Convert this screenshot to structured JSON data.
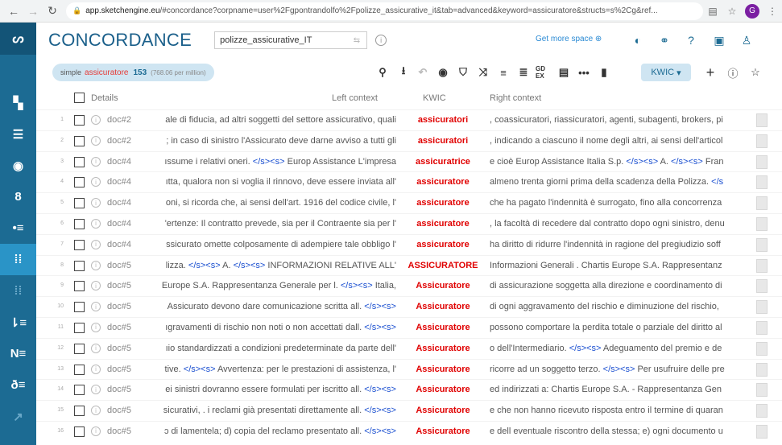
{
  "browser": {
    "url_host": "app.sketchengine.eu",
    "url_rest": "/#concordance?corpname=user%2Fgpontrandolfo%2Fpolizze_assicurative_it&tab=advanced&keyword=assicuratore&structs=s%2Cg&ref...",
    "profile_letter": "G"
  },
  "header": {
    "title": "CONCORDANCE",
    "corpus_name": "polizze_assicurative_IT",
    "get_more_space": "Get more space"
  },
  "query": {
    "type": "simple",
    "keyword": "assicuratore",
    "hits": "153",
    "per_million": "(768.06 per million)"
  },
  "toolbar": {
    "view_mode": "KWIC"
  },
  "columns": {
    "details": "Details",
    "left": "Left context",
    "kwic": "KWIC",
    "right": "Right context"
  },
  "rows": [
    {
      "n": "1",
      "doc": "doc#2",
      "left": "ale di fiducia, ad altri soggetti del settore assicurativo, quali",
      "kwic": "assicuratori",
      "right": ", coassicuratori, riassicuratori, agenti, subagenti, brokers, pi"
    },
    {
      "n": "2",
      "doc": "doc#2",
      "left": "; in caso di sinistro l'Assicurato deve darne avviso a tutti gli",
      "kwic": "assicuratori",
      "right": ", indicando a ciascuno il nome degli altri, ai sensi dell'articol"
    },
    {
      "n": "3",
      "doc": "doc#4",
      "left": "ıssume i relativi oneri. </s><s> Europ Assistance L'impresa",
      "kwic": "assicuratrice",
      "right": "e cioè Europ Assistance Italia S.p. </s><s> A. </s><s> Fran"
    },
    {
      "n": "4",
      "doc": "doc#4",
      "left": "ıtta, qualora non si voglia il rinnovo, deve essere inviata all'",
      "kwic": "assicuratore",
      "right": "almeno trenta giorni prima della scadenza della Polizza. </s"
    },
    {
      "n": "5",
      "doc": "doc#4",
      "left": "oni, si ricorda che, ai sensi dell'art. 1916 del codice civile, l'",
      "kwic": "assicuratore",
      "right": "che ha pagato l'indennità è surrogato, fino alla concorrenza"
    },
    {
      "n": "6",
      "doc": "doc#4",
      "left": "'ertenze: Il contratto prevede, sia per il Contraente sia per l'",
      "kwic": "assicuratore",
      "right": ", la facoltà di recedere dal contratto dopo ogni sinistro, denu"
    },
    {
      "n": "7",
      "doc": "doc#4",
      "left": "ssicurato omette colposamente di adempiere tale obbligo l'",
      "kwic": "assicuratore",
      "right": "ha diritto di ridurre l'indennità in ragione del pregiudizio soff"
    },
    {
      "n": "8",
      "doc": "doc#5",
      "left": "lizza. </s><s> A. </s><s> INFORMAZIONI RELATIVE ALL'",
      "kwic": "ASSICURATORE",
      "right": "Informazioni Generali . Chartis Europe S.A. Rappresentanz"
    },
    {
      "n": "9",
      "doc": "doc#5",
      "left": "Europe S.A. Rappresentanza Generale per l. </s><s> Italia,",
      "kwic": "Assicuratore",
      "right": "di assicurazione soggetta alla direzione e coordinamento di"
    },
    {
      "n": "10",
      "doc": "doc#5",
      "left": "Assicurato devono dare comunicazione scritta all. </s><s>",
      "kwic": "Assicuratore",
      "right": "di ogni aggravamento del rischio e diminuzione del rischio,"
    },
    {
      "n": "11",
      "doc": "doc#5",
      "left": "ıgravamenti di rischio non noti o non accettati dall. </s><s>",
      "kwic": "Assicuratore",
      "right": "possono comportare la perdita totale o parziale del diritto al"
    },
    {
      "n": "12",
      "doc": "doc#5",
      "left": "ıio standardizzati a condizioni predeterminate da parte dell'",
      "kwic": "Assicuratore",
      "right": "o dell'Intermediario. </s><s> Adeguamento del premio e de"
    },
    {
      "n": "13",
      "doc": "doc#5",
      "left": "tive. </s><s> Avvertenza: per le prestazioni di assistenza, l'",
      "kwic": "Assicuratore",
      "right": "ricorre ad un soggetto terzo. </s><s> Per usufruire delle pre"
    },
    {
      "n": "14",
      "doc": "doc#5",
      "left": "ei sinistri dovranno essere formulati per iscritto all. </s><s>",
      "kwic": "Assicuratore",
      "right": "ed indirizzati a: Chartis Europe S.A. - Rappresentanza Gen"
    },
    {
      "n": "15",
      "doc": "doc#5",
      "left": "sicurativi, . i reclami già presentati direttamente all. </s><s>",
      "kwic": "Assicuratore",
      "right": "e che non hanno ricevuto risposta entro il termine di quaran"
    },
    {
      "n": "16",
      "doc": "doc#5",
      "left": "ɔ di lamentela; d) copia del reclamo presentato all. </s><s>",
      "kwic": "Assicuratore",
      "right": "e dell eventuale riscontro della stessa; e) ogni documento u"
    }
  ]
}
